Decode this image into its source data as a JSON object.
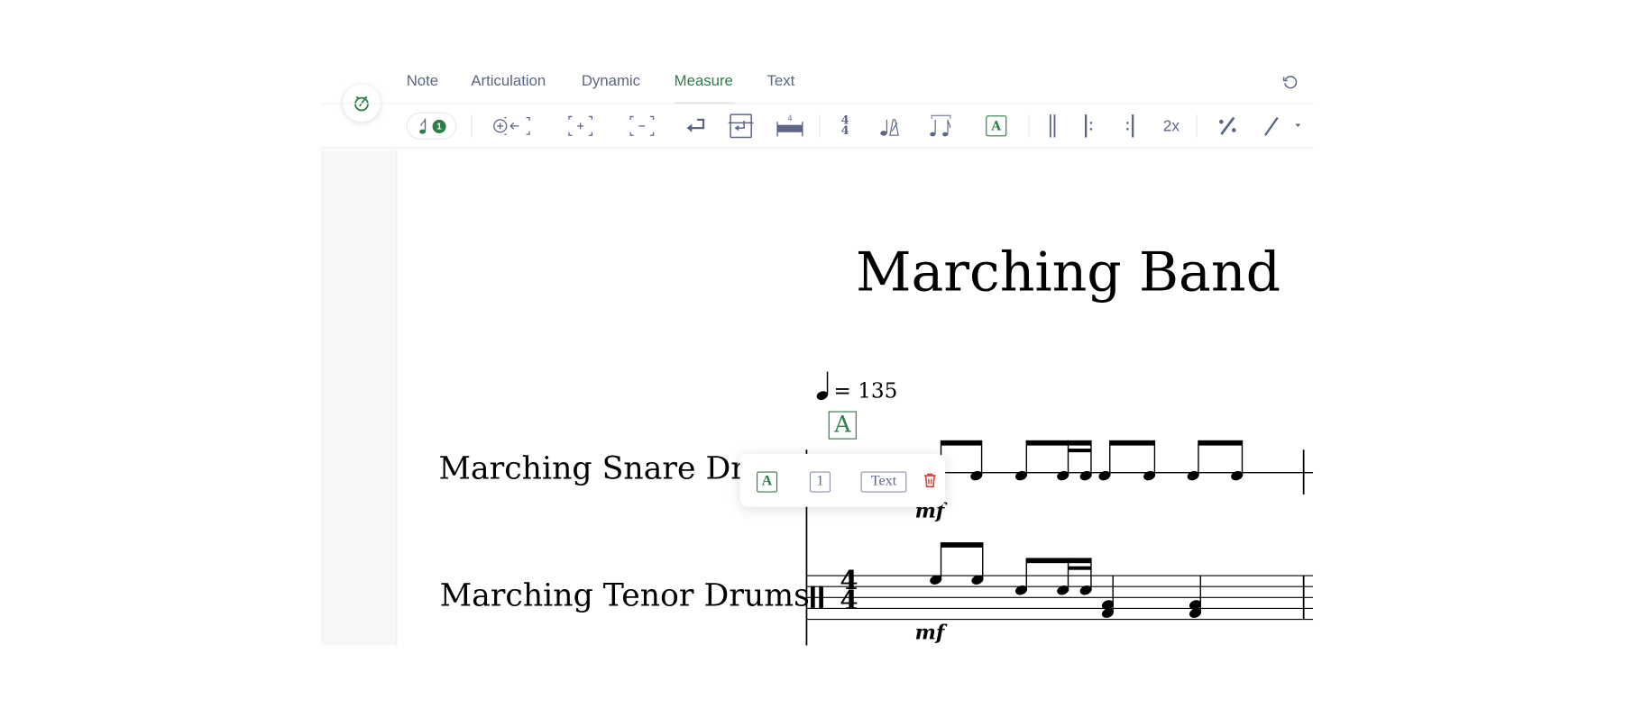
{
  "tabs": [
    {
      "label": "Note"
    },
    {
      "label": "Articulation"
    },
    {
      "label": "Dynamic"
    },
    {
      "label": "Measure",
      "active": true
    },
    {
      "label": "Text"
    }
  ],
  "toolbar": {
    "voice_badge": "1",
    "time_sig_top": "4",
    "time_sig_bottom": "4",
    "multirest_count": "4",
    "repeat_count_label": "2x",
    "rehearsal_label": "A"
  },
  "icons": [
    "metronome-icon",
    "undo-icon",
    "voice-note-icon",
    "insert-measure-before-icon",
    "add-measure-icon",
    "remove-measure-icon",
    "line-break-icon",
    "page-break-icon",
    "multimeasure-rest-icon",
    "time-signature-icon",
    "tempo-icon",
    "tuplet-icon",
    "rehearsal-mark-icon",
    "barline-icon",
    "repeat-start-icon",
    "repeat-end-icon",
    "measure-repeat-icon",
    "slash-icon",
    "trash-icon"
  ],
  "score": {
    "title": "Marching Band",
    "tempo": "= 135",
    "rehearsal_mark": "A",
    "staves": [
      {
        "name": "Marching Snare Drum",
        "dynamic": "mf"
      },
      {
        "name": "Marching Tenor Drums",
        "dynamic": "mf"
      }
    ],
    "time_signature": {
      "top": "4",
      "bottom": "4"
    }
  },
  "popup": {
    "rehearsal": "A",
    "number": "1",
    "text": "Text"
  },
  "colors": {
    "accent": "#2f7d47",
    "icon": "#5b6686",
    "danger": "#d9403a"
  }
}
